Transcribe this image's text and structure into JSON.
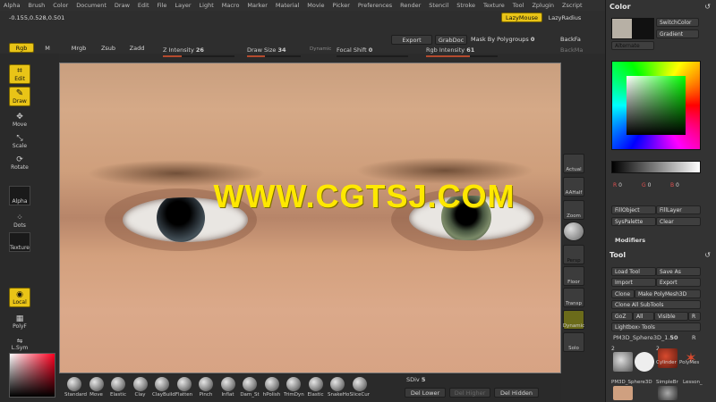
{
  "menu": [
    "Alpha",
    "Brush",
    "Color",
    "Document",
    "Draw",
    "Edit",
    "File",
    "Layer",
    "Light",
    "Macro",
    "Marker",
    "Material",
    "Movie",
    "Picker",
    "Preferences",
    "Render",
    "Stencil",
    "Stroke",
    "Texture",
    "Tool",
    "Zplugin",
    "Zscript"
  ],
  "header": {
    "coords": "-0.155,0.528,0.501",
    "lazymouse": "LazyMouse",
    "lazyradius": "LazyRadius"
  },
  "toolbar": {
    "rgb": "Rgb",
    "m": "M",
    "mrgb": "Mrgb",
    "zsub": "Zsub",
    "zadd": "Zadd",
    "z_intensity_label": "Z Intensity",
    "z_intensity_value": "26",
    "draw_size_label": "Draw Size",
    "draw_size_value": "34",
    "dynamic": "Dynamic",
    "focal_shift_label": "Focal Shift",
    "focal_shift_value": "0",
    "rgb_intensity_label": "Rgb Intensity",
    "rgb_intensity_value": "61",
    "export": "Export",
    "grabdoc": "GrabDoc",
    "mask_polygroups_label": "Mask By Polygroups",
    "mask_polygroups_value": "0",
    "backfa": "BackFa",
    "backma": "BackMa",
    "z_intensity_level": 0.26,
    "draw_size_level": 0.34,
    "rgb_intensity_level": 0.61
  },
  "left": {
    "edit": "Edit",
    "draw": "Draw",
    "move": "Move",
    "scale": "Scale",
    "rotate": "Rotate",
    "alpha": "Alpha",
    "dots": "Dots",
    "texture": "Texture",
    "local": "Local",
    "polyf": "PolyF",
    "lsym": "L.Sym"
  },
  "canvas": {
    "watermark": "WWW.CGTSJ.COM"
  },
  "dock": {
    "actual": "Actual",
    "aahalf": "AAHalf",
    "zoom": "Zoom",
    "persp": "Persp",
    "floor": "Floor",
    "transp": "Transp",
    "dynamic": "Dynamic",
    "solo": "Solo"
  },
  "brushes": [
    "Standard",
    "Move",
    "Elastic",
    "Clay",
    "ClayBuild",
    "Flatten",
    "Pinch",
    "Inflat",
    "Dam_St",
    "hPolish",
    "TrimDyn",
    "Elastic",
    "SnakeHo",
    "SliceCur"
  ],
  "bottom": {
    "sdiv_label": "SDiv",
    "sdiv_value": "5",
    "del_lower": "Del Lower",
    "del_higher": "Del Higher",
    "del_hidden": "Del Hidden"
  },
  "color_panel": {
    "title": "Color",
    "switchcolor": "SwitchColor",
    "gradient": "Gradient",
    "alternate": "Alternate",
    "r_label": "R",
    "r_value": "0",
    "g_label": "G",
    "g_value": "0",
    "b_label": "B",
    "b_value": "0",
    "fillobject": "FillObject",
    "filllayer": "FillLayer",
    "syspalette": "SysPalette",
    "clear": "Clear",
    "modifiers": "Modifiers"
  },
  "tool_panel": {
    "title": "Tool",
    "load_tool": "Load Tool",
    "save_as": "Save As",
    "import": "Import",
    "export": "Export",
    "clone": "Clone",
    "make_polymesh": "Make PolyMesh3D",
    "clone_all": "Clone All SubTools",
    "goz": "GoZ",
    "all": "All",
    "visible": "Visible",
    "r": "R",
    "lightbox": "Lightbox› Tools",
    "current_tool": "PM3D_Sphere3D_1.",
    "current_value": "50",
    "r2": "R",
    "thumb_count_a": "2",
    "thumb_count_b": "2",
    "cylinder": "Cylinder",
    "polymes": "PolyMes",
    "pm3d_label": "PM3D_Sphere3D",
    "simplebr": "SimpleBr",
    "lesson": "Lesson_"
  },
  "colors": {
    "accent": "#e9c417",
    "slider_fill": "#b44a2e",
    "panel": "#333333"
  }
}
